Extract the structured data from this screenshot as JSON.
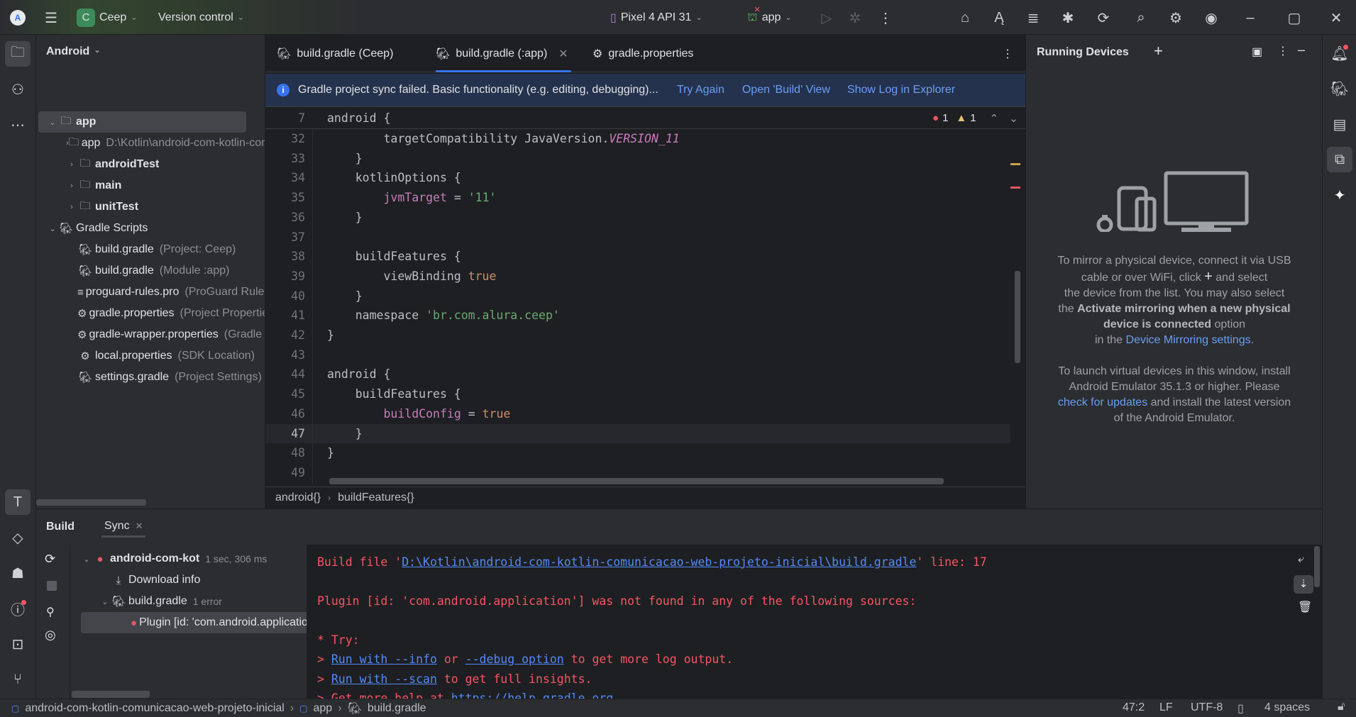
{
  "titlebar": {
    "project_initial": "C",
    "project_name": "Ceep",
    "vcs": "Version control",
    "device": "Pixel 4 API 31",
    "run_config": "app",
    "colors": {
      "project_badge": "#3d8b5a",
      "accent": "#3574f0"
    }
  },
  "project_panel": {
    "view": "Android",
    "tree": [
      {
        "label": "app",
        "hint": "",
        "level": 0,
        "expanded": true,
        "icon": "module-folder-icon",
        "bold": true,
        "selected": true
      },
      {
        "label": "app",
        "hint": "D:\\Kotlin\\android-com-kotlin-comunicacao-web-projeto-inicial",
        "level": 1,
        "expanded": false,
        "icon": "module-folder-icon"
      },
      {
        "label": "androidTest",
        "hint": "",
        "level": 1,
        "expanded": false,
        "icon": "module-folder-icon",
        "bold": true
      },
      {
        "label": "main",
        "hint": "",
        "level": 1,
        "expanded": false,
        "icon": "module-folder-icon",
        "bold": true
      },
      {
        "label": "unitTest",
        "hint": "",
        "level": 1,
        "expanded": false,
        "icon": "module-folder-icon",
        "bold": true
      },
      {
        "label": "Gradle Scripts",
        "hint": "",
        "level": 0,
        "expanded": true,
        "icon": "gradle-icon"
      },
      {
        "label": "build.gradle",
        "hint": "(Project: Ceep)",
        "level": 2,
        "icon": "gradle-icon"
      },
      {
        "label": "build.gradle",
        "hint": "(Module :app)",
        "level": 2,
        "icon": "gradle-icon"
      },
      {
        "label": "proguard-rules.pro",
        "hint": "(ProGuard Rules for \":app\")",
        "level": 2,
        "icon": "text-file-icon"
      },
      {
        "label": "gradle.properties",
        "hint": "(Project Properties)",
        "level": 2,
        "icon": "gear-icon"
      },
      {
        "label": "gradle-wrapper.properties",
        "hint": "(Gradle Version)",
        "level": 2,
        "icon": "gear-icon"
      },
      {
        "label": "local.properties",
        "hint": "(SDK Location)",
        "level": 2,
        "icon": "gear-icon"
      },
      {
        "label": "settings.gradle",
        "hint": "(Project Settings)",
        "level": 2,
        "icon": "gradle-icon"
      }
    ]
  },
  "editor": {
    "tabs": [
      {
        "label": "build.gradle (Ceep)",
        "icon": "gradle-icon",
        "active": false
      },
      {
        "label": "build.gradle (:app)",
        "icon": "gradle-icon",
        "active": true
      },
      {
        "label": "gradle.properties",
        "icon": "gear-icon",
        "active": false
      }
    ],
    "banner": {
      "message": "Gradle project sync failed. Basic functionality (e.g. editing, debugging)...",
      "actions": [
        "Try Again",
        "Open 'Build' View",
        "Show Log in Explorer"
      ]
    },
    "sticky": {
      "line": "7",
      "text": "android {"
    },
    "inspections": {
      "errors": "1",
      "warnings": "1"
    },
    "current_line": "47",
    "lines": [
      {
        "n": "32",
        "tokens": [
          {
            "t": "        targetCompatibility JavaVersion."
          },
          {
            "t": "VERSION_11",
            "c": "k-const"
          }
        ]
      },
      {
        "n": "33",
        "tokens": [
          {
            "t": "    }"
          }
        ]
      },
      {
        "n": "34",
        "tokens": [
          {
            "t": "    kotlinOptions {"
          }
        ]
      },
      {
        "n": "35",
        "tokens": [
          {
            "t": "        "
          },
          {
            "t": "jvmTarget",
            "c": "k-prop"
          },
          {
            "t": " = "
          },
          {
            "t": "'11'",
            "c": "k-str"
          }
        ]
      },
      {
        "n": "36",
        "tokens": [
          {
            "t": "    }"
          }
        ]
      },
      {
        "n": "37",
        "tokens": []
      },
      {
        "n": "38",
        "tokens": [
          {
            "t": "    buildFeatures {"
          }
        ]
      },
      {
        "n": "39",
        "tokens": [
          {
            "t": "        viewBinding "
          },
          {
            "t": "true",
            "c": "k-kw"
          }
        ]
      },
      {
        "n": "40",
        "tokens": [
          {
            "t": "    }"
          }
        ]
      },
      {
        "n": "41",
        "tokens": [
          {
            "t": "    namespace "
          },
          {
            "t": "'br.com.alura.ceep'",
            "c": "k-str"
          }
        ]
      },
      {
        "n": "42",
        "tokens": [
          {
            "t": "}"
          }
        ]
      },
      {
        "n": "43",
        "tokens": []
      },
      {
        "n": "44",
        "tokens": [
          {
            "t": "android {"
          }
        ]
      },
      {
        "n": "45",
        "tokens": [
          {
            "t": "    buildFeatures {"
          }
        ]
      },
      {
        "n": "46",
        "tokens": [
          {
            "t": "        "
          },
          {
            "t": "buildConfig",
            "c": "k-prop"
          },
          {
            "t": " = "
          },
          {
            "t": "true",
            "c": "k-kw"
          }
        ]
      },
      {
        "n": "47",
        "tokens": [
          {
            "t": "    }"
          }
        ]
      },
      {
        "n": "48",
        "tokens": [
          {
            "t": "}"
          }
        ]
      },
      {
        "n": "49",
        "tokens": []
      }
    ],
    "breadcrumb": [
      "android{}",
      "buildFeatures{}"
    ]
  },
  "running_devices": {
    "title": "Running Devices",
    "p1_a": "To mirror a physical device, connect it via USB",
    "p1_b1": "cable or over WiFi, click",
    "p1_b2": "and select",
    "p1_c": "the device from the list. You may also select",
    "p1_d1": "the",
    "p1_d2": "Activate mirroring when a new physical",
    "p1_e1": "device is connected",
    "p1_e2": "option",
    "p1_f1": "in the",
    "p1_f_link": "Device Mirroring settings",
    "p1_f2": ".",
    "p2_a": "To launch virtual devices in this window, install",
    "p2_b": "Android Emulator 35.1.3 or higher. Please",
    "p2_c_link": "check for updates",
    "p2_c2": "and install the latest version",
    "p2_d": "of the Android Emulator."
  },
  "build_panel": {
    "tabs": [
      "Build",
      "Sync"
    ],
    "tree": [
      {
        "label": "android-com-kot",
        "hint": "1 sec, 306 ms",
        "icon": "error-icon"
      },
      {
        "label": "Download info",
        "hint": "",
        "icon": "download-icon"
      },
      {
        "label": "build.gradle",
        "hint": "1 error",
        "icon": "gradle-icon"
      },
      {
        "label": "Plugin [id: 'com.android.application'] was not found",
        "hint": "",
        "icon": "error-icon"
      }
    ],
    "console": {
      "l1_a": "Build file '",
      "l1_link": "D:\\Kotlin\\android-com-kotlin-comunicacao-web-projeto-inicial\\build.gradle",
      "l1_b": "' line: 17",
      "l2": "Plugin [id: 'com.android.application'] was not found in any of the following sources:",
      "l3": "* Try:",
      "l4_a": "> ",
      "l4_link1": "Run with --info",
      "l4_b": " or ",
      "l4_link2": "--debug option",
      "l4_c": " to get more log output.",
      "l5_a": "> ",
      "l5_link": "Run with --scan",
      "l5_b": " to get full insights.",
      "l6_a": "> Get more help at ",
      "l6_link": "https://help.gradle.org",
      "l6_b": "."
    }
  },
  "statusbar": {
    "path": [
      "android-com-kotlin-comunicacao-web-projeto-inicial",
      "app",
      "build.gradle"
    ],
    "position": "47:2",
    "line_sep": "LF",
    "encoding": "UTF-8",
    "indent": "4 spaces"
  }
}
